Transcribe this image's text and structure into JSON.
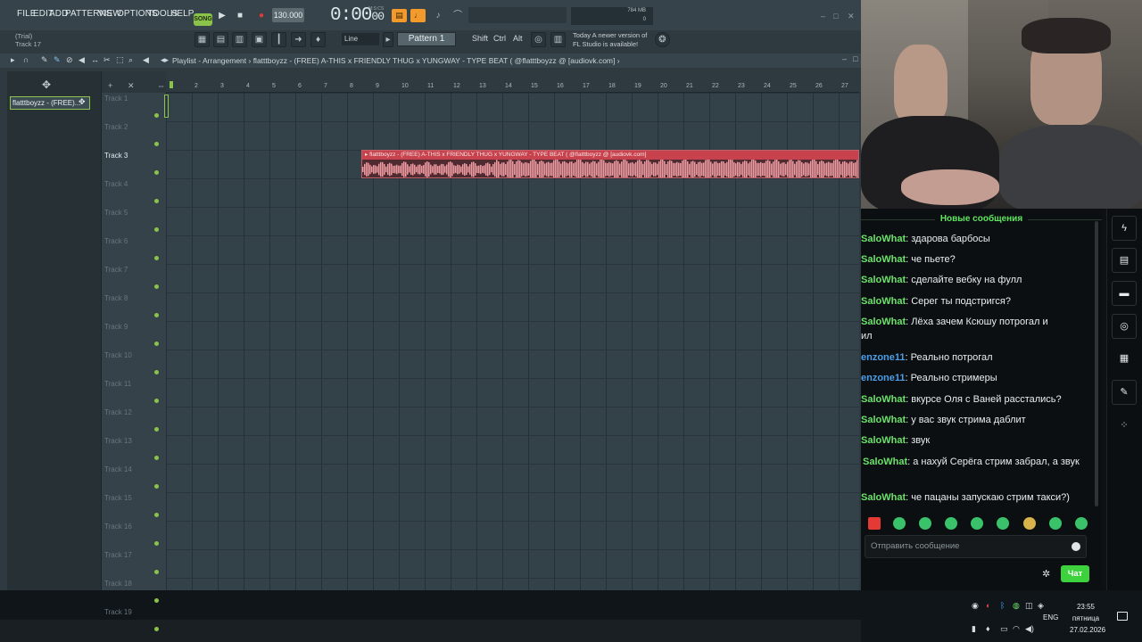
{
  "fl": {
    "menus": [
      "FILE",
      "EDIT",
      "ADD",
      "PATTERNS",
      "VIEW",
      "OPTIONS",
      "TOOLS",
      "HELP"
    ],
    "song_label": "SONG",
    "tempo": "130.000",
    "clock_main": "0:00",
    "clock_small": "00",
    "clock_unit": "M:S:CS",
    "trial_line1": "(Trial)",
    "trial_line2": "Track 17",
    "snap": "Line",
    "pattern": "Pattern 1",
    "mod_keys": [
      "Shift",
      "Ctrl",
      "Alt"
    ],
    "newer_notice_line1": "Today  A newer version of",
    "newer_notice_line2": "FL Studio is available!",
    "mem": "784 MB",
    "cpu": "0"
  },
  "playlist": {
    "breadcrumb": "Playlist - Arrangement › flatttboyzz - (FREE) A-THIS x FRIENDLY THUG x YUNGWAY - TYPE BEAT ( @flatttboyzz @ [audiovk.com] ›",
    "browser_item": "flatttboyzz - (FREE)...",
    "ruler": [
      "2",
      "3",
      "4",
      "5",
      "6",
      "7",
      "8",
      "9",
      "10",
      "11",
      "12",
      "13",
      "14",
      "15",
      "16",
      "17",
      "18",
      "19",
      "20",
      "21",
      "22",
      "23",
      "24",
      "25",
      "26",
      "27"
    ],
    "tracks": [
      "Track 1",
      "Track 2",
      "Track 3",
      "Track 4",
      "Track 5",
      "Track 6",
      "Track 7",
      "Track 8",
      "Track 9",
      "Track 10",
      "Track 11",
      "Track 12",
      "Track 13",
      "Track 14",
      "Track 15",
      "Track 16",
      "Track 17",
      "Track 18",
      "Track 19"
    ],
    "clip_title": "▸ flatttboyzz - (FREE) A-THIS x FRIENDLY THUG x YUNGWAY - TYPE BEAT ( @flatttboyzz @ [audiovk.com]"
  },
  "chat": {
    "header": "Новые сообщения",
    "messages": [
      {
        "nick": "SaloWhat",
        "text": ": здарова барбосы",
        "color": "green"
      },
      {
        "nick": "SaloWhat",
        "text": ": че пьете?",
        "color": "green"
      },
      {
        "nick": "SaloWhat",
        "text": ": сделайте вебку на фулл",
        "color": "green"
      },
      {
        "nick": "SaloWhat",
        "text": ": Серег ты подстригся?",
        "color": "green"
      },
      {
        "nick": "SaloWhat",
        "text": ": Лёха зачем Ксюшу потрогал и",
        "color": "green",
        "wrap": "ил"
      },
      {
        "nick": "enzone11",
        "text": ": Реально потрогал",
        "color": "blue"
      },
      {
        "nick": "enzone11",
        "text": ": Реально стримеры",
        "color": "blue"
      },
      {
        "nick": "SaloWhat",
        "text": ": вкурсе Оля с Ваней расстались?",
        "color": "green"
      },
      {
        "nick": "SaloWhat",
        "text": ": у вас звук стрима даблит",
        "color": "green"
      },
      {
        "nick": "SaloWhat",
        "text": ": звук",
        "color": "green"
      },
      {
        "nick": "SaloWhat",
        "text": ": а нахуй Серёга стрим забрал, а звук",
        "color": "green"
      },
      {
        "nick": "SaloWhat",
        "text": ": че пацаны запускаю стрим такси?)",
        "color": "green"
      }
    ],
    "input_placeholder": "Отправить сообщение",
    "send_label": "Чат"
  },
  "taskbar": {
    "lang": "ENG",
    "time": "23:55",
    "weekday": "пятница",
    "date": "27.02.2026"
  }
}
